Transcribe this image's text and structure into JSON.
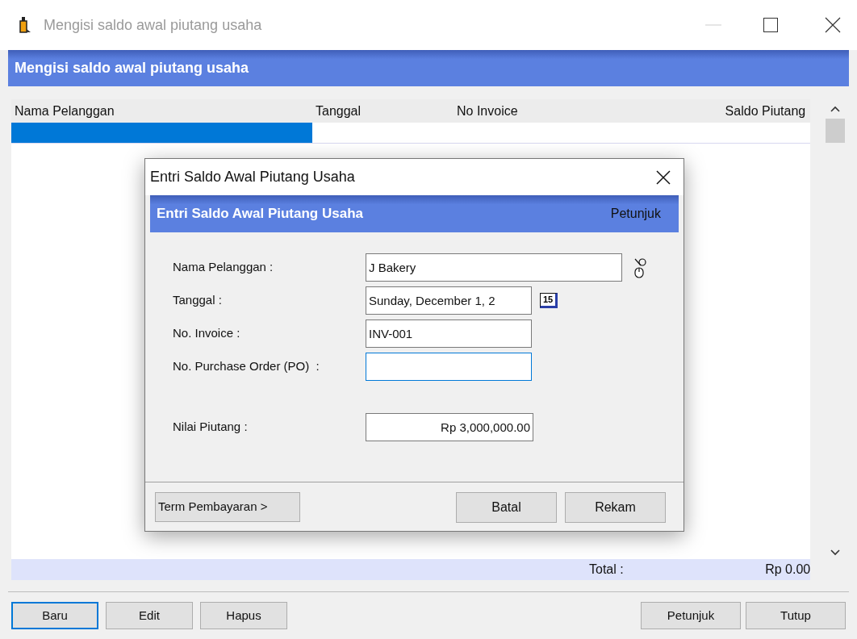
{
  "window": {
    "title": "Mengisi saldo awal piutang usaha"
  },
  "header": {
    "title": "Mengisi saldo awal piutang usaha"
  },
  "table": {
    "columns": [
      "Nama Pelanggan",
      "Tanggal",
      "No Invoice",
      "Saldo Piutang"
    ],
    "rows": [
      {
        "selected": true
      }
    ]
  },
  "total": {
    "label": "Total :",
    "value": "Rp 0.00"
  },
  "buttons_left": [
    {
      "label": "Baru",
      "focused": true
    },
    {
      "label": "Edit",
      "focused": false
    },
    {
      "label": "Hapus",
      "focused": false
    }
  ],
  "buttons_right": [
    {
      "label": "Petunjuk"
    },
    {
      "label": "Tutup"
    }
  ],
  "dialog": {
    "title": "Entri Saldo Awal Piutang Usaha",
    "header": "Entri Saldo Awal Piutang Usaha",
    "help_link": "Petunjuk",
    "fields": [
      {
        "kind": "lookup",
        "label": "Nama Pelanggan :",
        "value": "J Bakery",
        "focused": false
      },
      {
        "kind": "date",
        "label": "Tanggal :",
        "value": "Sunday, December 1, 2",
        "calendar": "15",
        "focused": false
      },
      {
        "kind": "text",
        "label": "No. Invoice :",
        "value": "INV-001",
        "focused": false
      },
      {
        "kind": "text",
        "label": "No. Purchase Order (PO)  :",
        "focused": true
      },
      {
        "kind": "amount",
        "label": "Nilai Piutang :",
        "value": "Rp 3,000,000.00",
        "focused": false
      }
    ],
    "term_button": "Term Pembayaran >",
    "buttons": [
      "Batal",
      "Rekam"
    ]
  }
}
